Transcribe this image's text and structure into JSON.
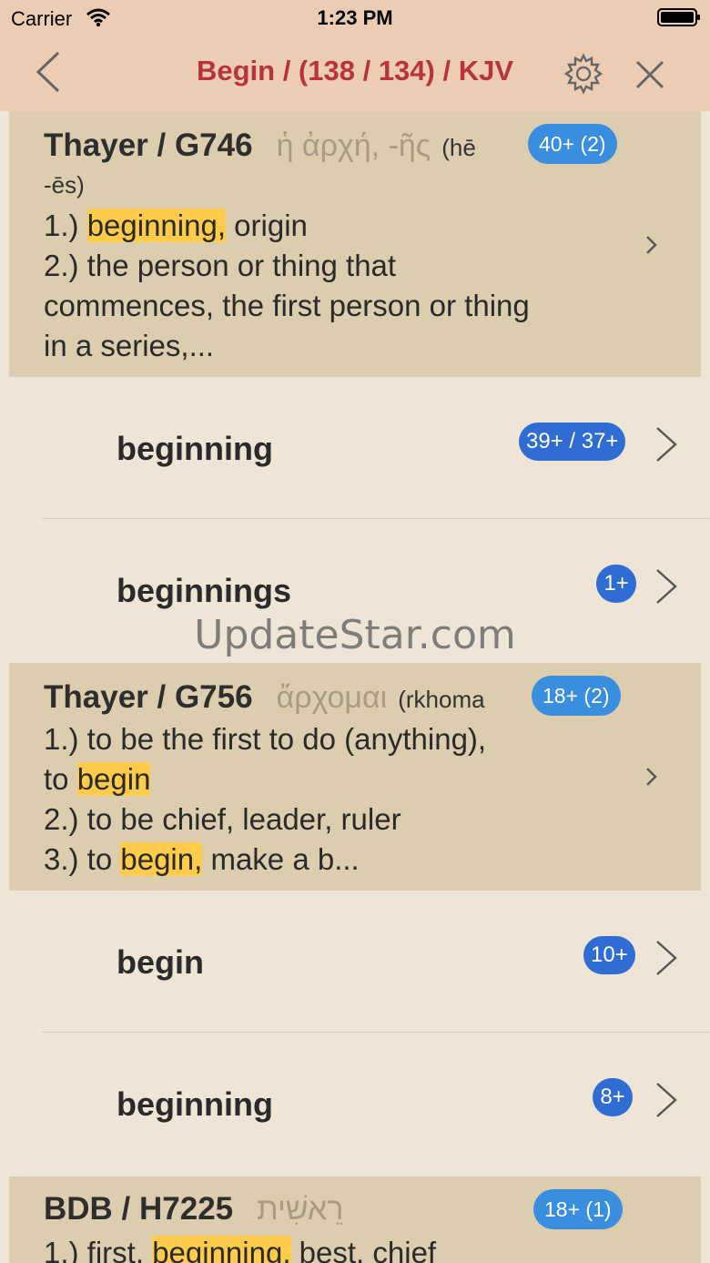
{
  "status": {
    "carrier": "Carrier",
    "time": "1:23 PM"
  },
  "nav": {
    "title": "Begin /  (138 / 134) / KJV"
  },
  "entries": [
    {
      "source": "Thayer / G746",
      "word": "ἡ ἀρχή, -ῆς",
      "translit": "(hē",
      "translit2": "-ēs)",
      "badge": "40+ (2)",
      "def": [
        {
          "pre": "1.) ",
          "hl": "beginning,",
          "post": " origin"
        },
        {
          "pre": "2.) the person or thing that",
          "hl": "",
          "post": ""
        },
        {
          "pre": "commences, the first person or thing",
          "hl": "",
          "post": ""
        },
        {
          "pre": "in a series,...",
          "hl": "",
          "post": ""
        }
      ]
    },
    {
      "source": "Thayer / G756",
      "word": "ἄρχομαι",
      "translit": "(rkhoma",
      "translit2": "",
      "badge": "18+ (2)",
      "def": [
        {
          "pre": "1.) to be the first to do (anything),",
          "hl": "",
          "post": ""
        },
        {
          "pre": "to ",
          "hl": "begin",
          "post": ""
        },
        {
          "pre": "2.) to be chief, leader, ruler",
          "hl": "",
          "post": ""
        },
        {
          "pre": "3.) to ",
          "hl": "begin,",
          "post": " make a b..."
        }
      ]
    },
    {
      "source": "BDB / H7225",
      "word": "רֵאשִׁית",
      "translit": "",
      "translit2": "",
      "badge": "18+ (1)",
      "def": [
        {
          "pre": "1.) first, ",
          "hl": "beginning,",
          "post": " best, chief"
        }
      ]
    }
  ],
  "rows": [
    {
      "label": "beginning",
      "badge": "39+ / 37+"
    },
    {
      "label": "beginnings",
      "badge": "1+"
    },
    {
      "label": "begin",
      "badge": "10+"
    },
    {
      "label": "beginning",
      "badge": "8+"
    }
  ],
  "watermark": "UpdateStar.com",
  "colors": {
    "bar": "#eccdb4",
    "title": "#b8343a",
    "entry_bg": "#dccdaf",
    "page_bg": "#efe5d6",
    "highlight": "#ffcb4a",
    "badge": "#3a8ee0"
  },
  "icons": {
    "back": "chevron-left-icon",
    "settings": "gear-icon",
    "close": "close-icon",
    "disclosure": "chevron-right-icon"
  }
}
